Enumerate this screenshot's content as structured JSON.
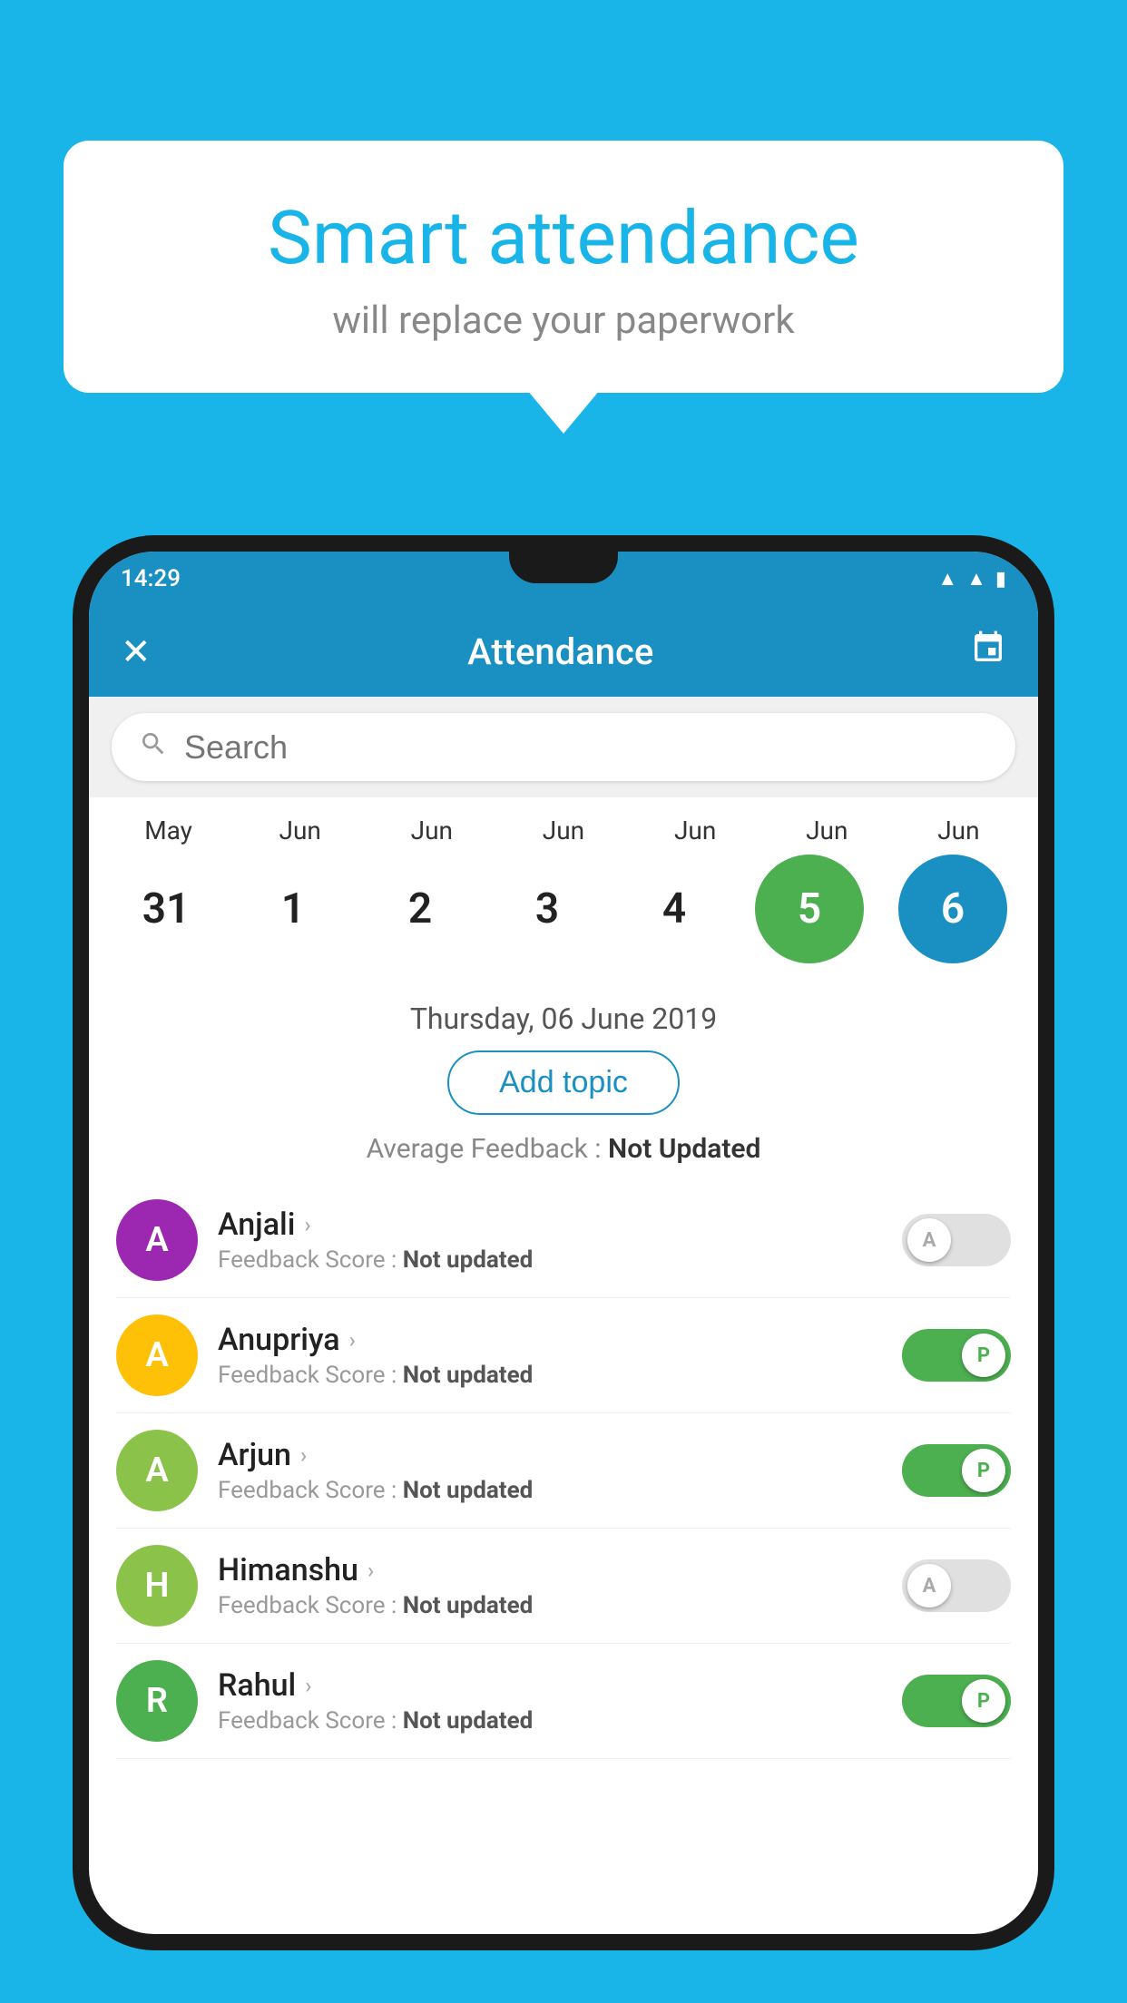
{
  "background_color": "#1ab5e8",
  "bubble": {
    "title": "Smart attendance",
    "subtitle": "will replace your paperwork"
  },
  "phone": {
    "status_bar": {
      "time": "14:29",
      "icons": [
        "wifi",
        "signal",
        "battery"
      ]
    },
    "app_bar": {
      "title": "Attendance",
      "close_label": "✕",
      "calendar_icon": "📅"
    },
    "search": {
      "placeholder": "Search"
    },
    "calendar": {
      "columns": [
        {
          "month": "May",
          "date": "31",
          "state": "normal"
        },
        {
          "month": "Jun",
          "date": "1",
          "state": "normal"
        },
        {
          "month": "Jun",
          "date": "2",
          "state": "normal"
        },
        {
          "month": "Jun",
          "date": "3",
          "state": "normal"
        },
        {
          "month": "Jun",
          "date": "4",
          "state": "normal"
        },
        {
          "month": "Jun",
          "date": "5",
          "state": "today"
        },
        {
          "month": "Jun",
          "date": "6",
          "state": "selected"
        }
      ]
    },
    "selected_date": "Thursday, 06 June 2019",
    "add_topic_label": "Add topic",
    "average_feedback_label": "Average Feedback :",
    "average_feedback_value": "Not Updated",
    "students": [
      {
        "name": "Anjali",
        "initial": "A",
        "avatar_color": "#9c27b0",
        "feedback_label": "Feedback Score :",
        "feedback_value": "Not updated",
        "toggle": "off",
        "toggle_letter": "A"
      },
      {
        "name": "Anupriya",
        "initial": "A",
        "avatar_color": "#ffc107",
        "feedback_label": "Feedback Score :",
        "feedback_value": "Not updated",
        "toggle": "on",
        "toggle_letter": "P"
      },
      {
        "name": "Arjun",
        "initial": "A",
        "avatar_color": "#8bc34a",
        "feedback_label": "Feedback Score :",
        "feedback_value": "Not updated",
        "toggle": "on",
        "toggle_letter": "P"
      },
      {
        "name": "Himanshu",
        "initial": "H",
        "avatar_color": "#8bc34a",
        "feedback_label": "Feedback Score :",
        "feedback_value": "Not updated",
        "toggle": "off",
        "toggle_letter": "A"
      },
      {
        "name": "Rahul",
        "initial": "R",
        "avatar_color": "#4caf50",
        "feedback_label": "Feedback Score :",
        "feedback_value": "Not updated",
        "toggle": "on",
        "toggle_letter": "P"
      }
    ]
  }
}
